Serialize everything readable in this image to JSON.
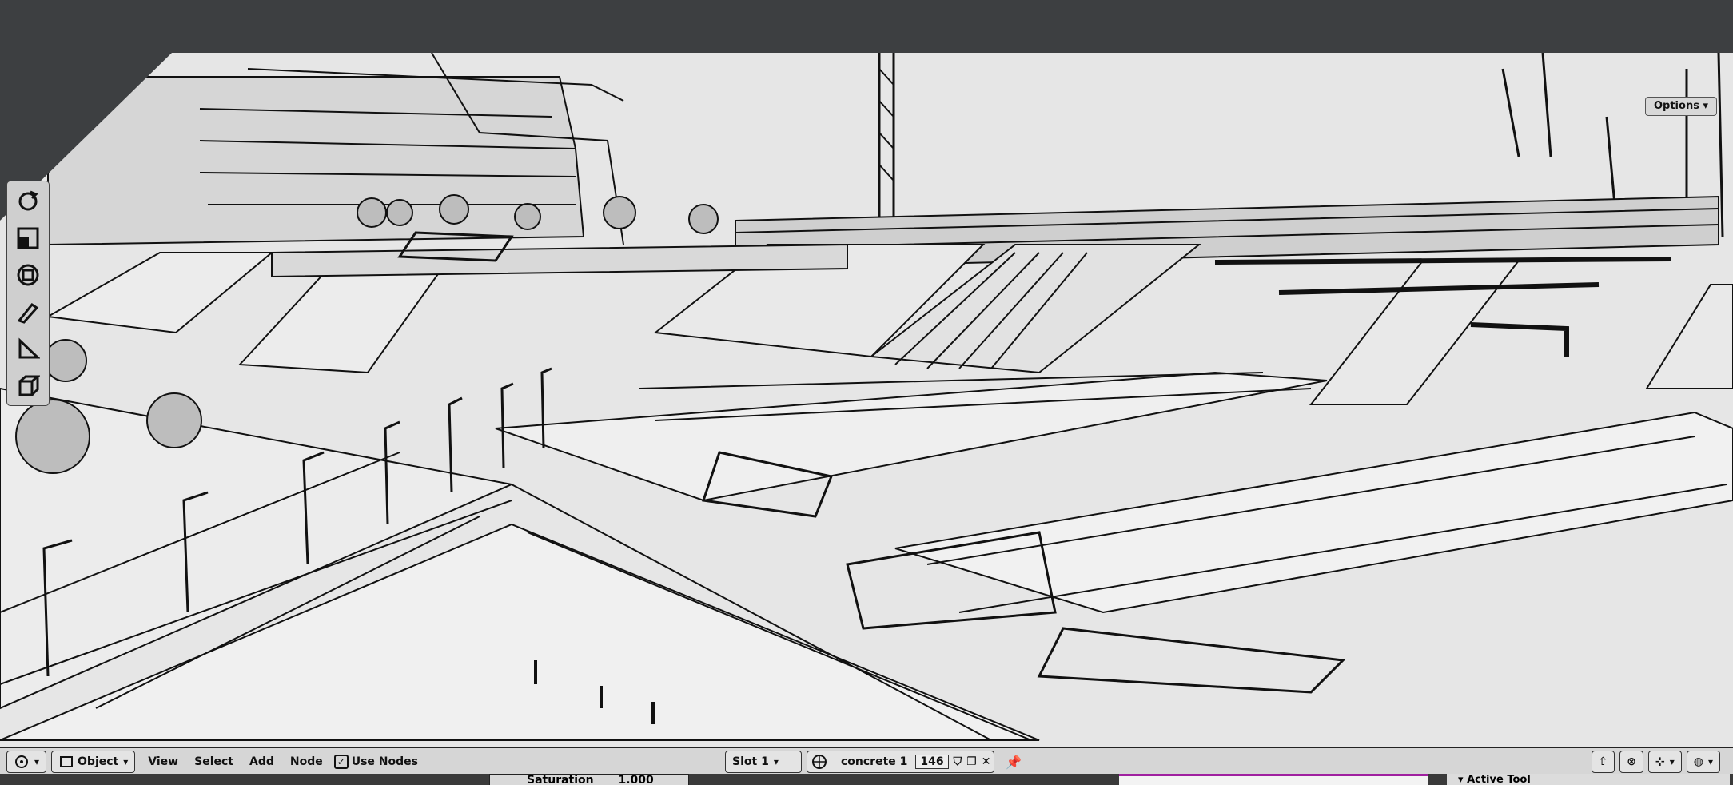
{
  "viewport": {
    "options_label": "Options"
  },
  "header": {
    "mode_label": "Object",
    "menus": [
      "View",
      "Select",
      "Add",
      "Node"
    ],
    "use_nodes_label": "Use Nodes",
    "use_nodes_checked": true,
    "slot_label": "Slot 1",
    "material_name": "concrete 1",
    "user_count": "146"
  },
  "below": {
    "saturation_label": "Saturation",
    "saturation_value": "1.000",
    "active_tool_label": "Active Tool"
  },
  "colors": {
    "viewport_bg": "#e6e6e6",
    "chrome_dark": "#3d3f41",
    "header_bg": "#d6d6d6",
    "accent_magenta": "#a020a0"
  }
}
